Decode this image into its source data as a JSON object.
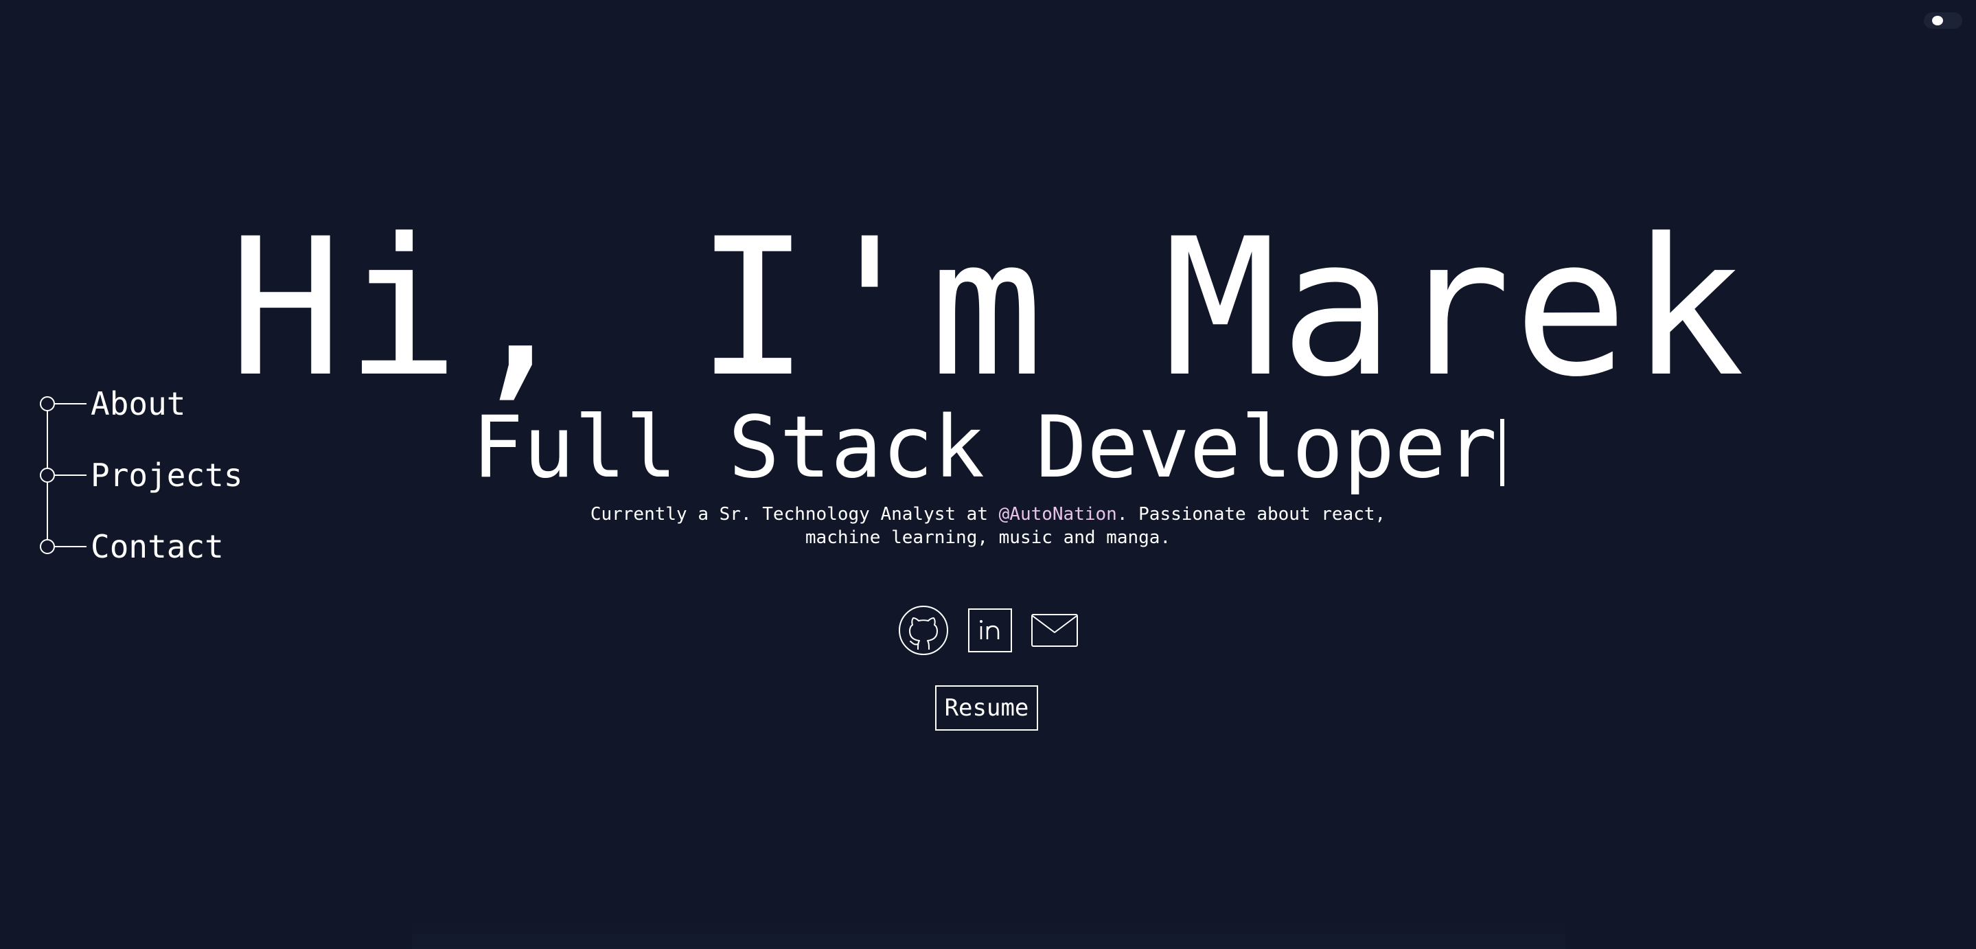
{
  "colors": {
    "background": "#111729",
    "text": "#ffffff",
    "accent": "#e7c3ea"
  },
  "theme_toggle": {
    "icon": "toggle-icon"
  },
  "nav": {
    "items": [
      {
        "label": "About"
      },
      {
        "label": "Projects"
      },
      {
        "label": "Contact"
      }
    ]
  },
  "hero": {
    "title": "Hi, I'm Marek",
    "subtitle": "Full Stack Developer",
    "description_pre": "Currently a Sr. Technology Analyst at ",
    "company": "@AutoNation",
    "description_post": ". Passionate about react,",
    "description_line2": "machine learning, music and manga."
  },
  "socials": [
    {
      "icon": "github-icon"
    },
    {
      "icon": "linkedin-icon"
    },
    {
      "icon": "mail-icon"
    }
  ],
  "resume_label": "Resume"
}
